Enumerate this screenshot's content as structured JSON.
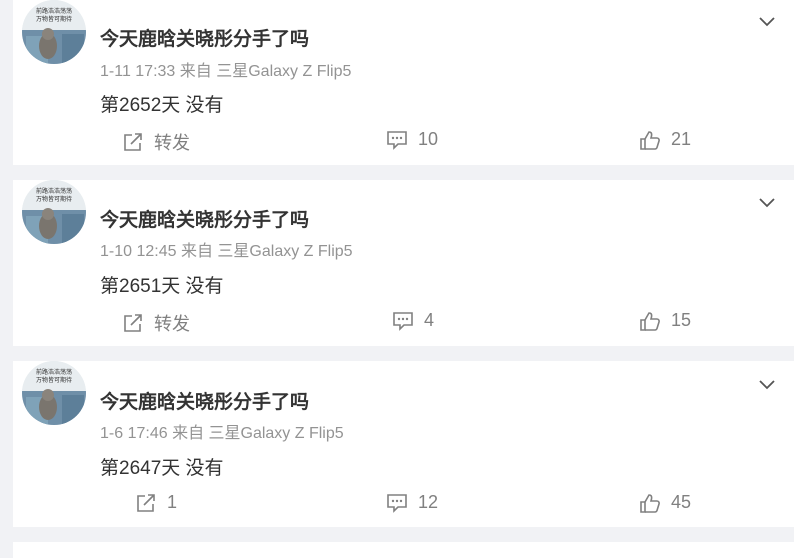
{
  "posts": [
    {
      "avatar_caption_line1": "前路浩浩荡荡",
      "avatar_caption_line2": "万物皆可期待",
      "username": "今天鹿晗关晓彤分手了吗",
      "timestamp": "1-11 17:33",
      "source": "来自 三星Galaxy Z Flip5",
      "text": "第2652天 没有",
      "repost_label": "转发",
      "comments": "10",
      "likes": "21"
    },
    {
      "avatar_caption_line1": "前路浩浩荡荡",
      "avatar_caption_line2": "万物皆可期待",
      "username": "今天鹿晗关晓彤分手了吗",
      "timestamp": "1-10 12:45",
      "source": "来自 三星Galaxy Z Flip5",
      "text": "第2651天 没有",
      "repost_label": "转发",
      "comments": "4",
      "likes": "15"
    },
    {
      "avatar_caption_line1": "前路浩浩荡荡",
      "avatar_caption_line2": "万物皆可期待",
      "username": "今天鹿晗关晓彤分手了吗",
      "timestamp": "1-6 17:46",
      "source": "来自 三星Galaxy Z Flip5",
      "text": "第2647天 没有",
      "repost_label": "1",
      "comments": "12",
      "likes": "45"
    }
  ],
  "icons": {
    "repost": "repost-icon",
    "comment": "comment-icon",
    "like": "like-icon",
    "more": "chevron-down-icon"
  },
  "colors": {
    "page_bg": "#f1f2f5",
    "card_bg": "#ffffff",
    "text": "#333333",
    "muted": "#939393",
    "action": "#808080"
  }
}
